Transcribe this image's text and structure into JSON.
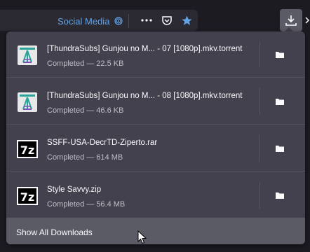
{
  "toolbar": {
    "bookmark_label": "Social Media",
    "icons": [
      "fingerprint-icon",
      "more-dots-icon",
      "pocket-icon",
      "bookmark-star-icon",
      "download-icon"
    ],
    "accent": "#62a4e8"
  },
  "downloads": [
    {
      "name": "[ThundraSubs] Gunjou no M... - 07 [1080p].mkv.torrent",
      "status": "Completed — 22.5 KB",
      "icon": "torrent-file-icon"
    },
    {
      "name": "[ThundraSubs] Gunjou no M... - 08 [1080p].mkv.torrent",
      "status": "Completed — 46.6 KB",
      "icon": "torrent-file-icon"
    },
    {
      "name": "SSFF-USA-DecrTD-Ziperto.rar",
      "status": "Completed — 614 MB",
      "icon": "7z-archive-icon"
    },
    {
      "name": "Style Savvy.zip",
      "status": "Completed — 56.4 MB",
      "icon": "7z-archive-icon"
    }
  ],
  "footer": {
    "label": "Show All Downloads"
  },
  "archive_icon_text": "7z"
}
